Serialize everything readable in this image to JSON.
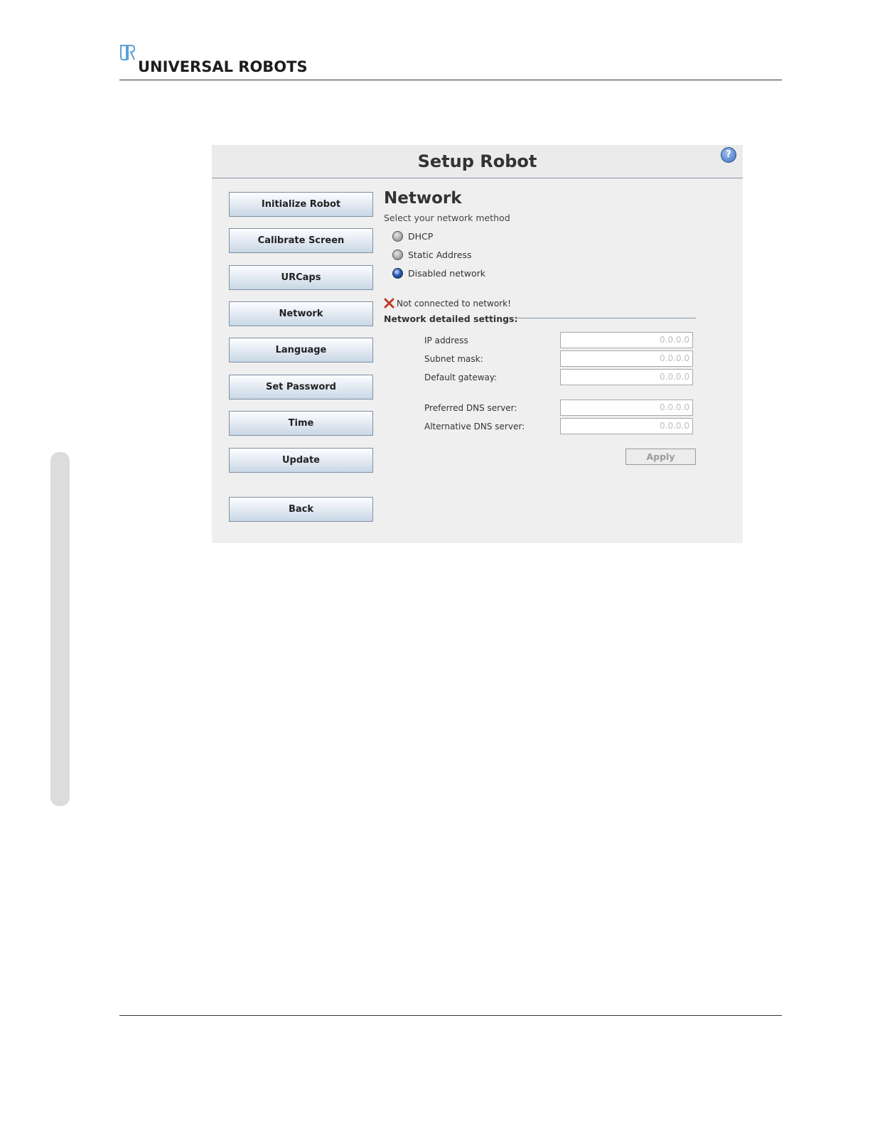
{
  "brand": {
    "logo_text": "UNIVERSAL ROBOTS",
    "mark_color": "#5aa0d8"
  },
  "window": {
    "title": "Setup Robot",
    "help_icon": "help-icon",
    "help_symbol": "?"
  },
  "nav": {
    "buttons": [
      {
        "label": "Initialize Robot"
      },
      {
        "label": "Calibrate Screen"
      },
      {
        "label": "URCaps"
      },
      {
        "label": "Network"
      },
      {
        "label": "Language"
      },
      {
        "label": "Set Password"
      },
      {
        "label": "Time"
      },
      {
        "label": "Update"
      }
    ],
    "back_label": "Back"
  },
  "network": {
    "title": "Network",
    "subtitle": "Select your network method",
    "options": [
      {
        "label": "DHCP",
        "selected": false
      },
      {
        "label": "Static Address",
        "selected": false
      },
      {
        "label": "Disabled network",
        "selected": true
      }
    ],
    "status_icon": "error-x-icon",
    "status_text": "Not connected to network!",
    "details_title": "Network detailed settings:",
    "fields": {
      "ip": {
        "label": "IP address",
        "value": "0.0.0.0"
      },
      "subnet": {
        "label": "Subnet mask:",
        "value": "0.0.0.0"
      },
      "gateway": {
        "label": "Default gateway:",
        "value": "0.0.0.0"
      },
      "dns_preferred": {
        "label": "Preferred DNS server:",
        "value": "0.0.0.0"
      },
      "dns_alternative": {
        "label": "Alternative DNS server:",
        "value": "0.0.0.0"
      }
    },
    "apply_label": "Apply"
  },
  "colors": {
    "accent": "#2c5bb5",
    "error": "#c0392b"
  }
}
